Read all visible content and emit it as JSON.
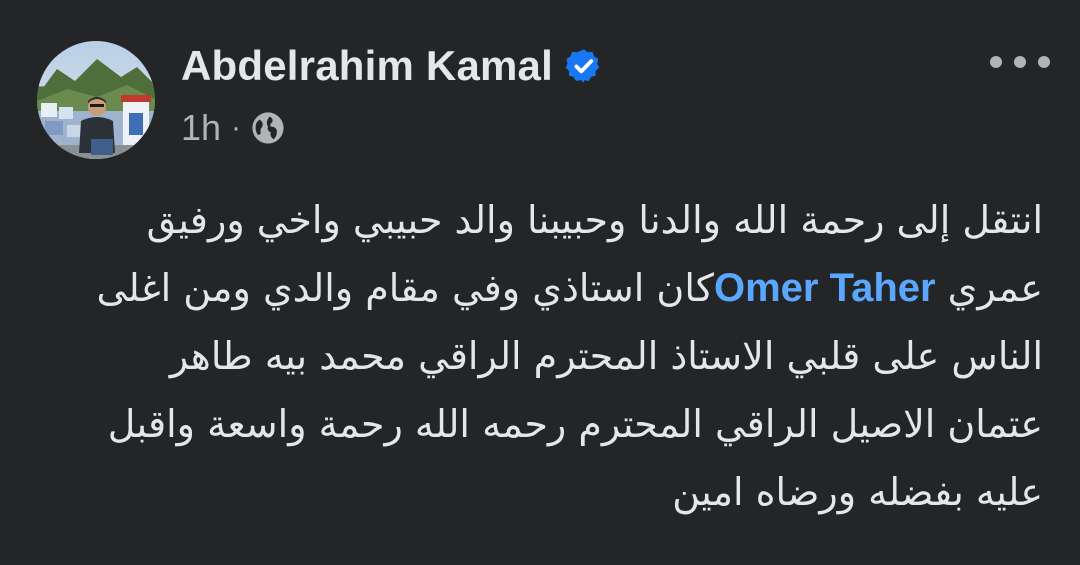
{
  "post": {
    "author": {
      "name": "Abdelrahim Kamal",
      "verified": true
    },
    "meta": {
      "time": "1h",
      "separator": "·",
      "audience_icon": "globe-icon"
    },
    "menu_icon": "more-horizontal-icon",
    "body": {
      "line1": "انتقل إلى رحمة الله والدنا وحبيبنا والد حبيبي واخي ورفيق",
      "line2_before": "عمري ",
      "mention": "Omer Taher",
      "line2_after": "كان استاذي وفي مقام والدي ومن اغلى",
      "line3": "الناس على قلبي الاستاذ المحترم الراقي محمد بيه طاهر",
      "line4": "عتمان الاصيل الراقي المحترم رحمه الله رحمة واسعة واقبل",
      "line5": "عليه بفضله ورضاه امين"
    }
  },
  "colors": {
    "background": "#242526",
    "text": "#e4e6eb",
    "secondary_text": "#b0b3b8",
    "mention": "#5aa7ff",
    "verified_badge": "#1877f2"
  }
}
